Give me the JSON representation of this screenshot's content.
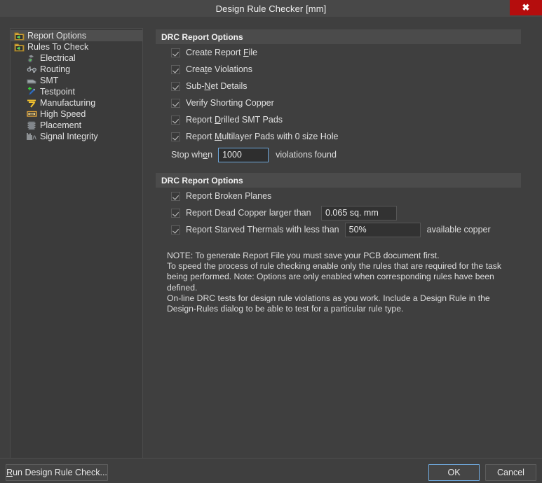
{
  "window": {
    "title": "Design Rule Checker [mm]",
    "close_label": "✖"
  },
  "sidebar": {
    "items": [
      {
        "label": "Report Options",
        "icon": "folder-arrow-icon",
        "level": 0,
        "selected": true
      },
      {
        "label": "Rules To Check",
        "icon": "folder-arrow-icon",
        "level": 0,
        "selected": false
      },
      {
        "label": "Electrical",
        "icon": "electrical-icon",
        "level": 1,
        "selected": false
      },
      {
        "label": "Routing",
        "icon": "routing-icon",
        "level": 1,
        "selected": false
      },
      {
        "label": "SMT",
        "icon": "smt-icon",
        "level": 1,
        "selected": false
      },
      {
        "label": "Testpoint",
        "icon": "testpoint-icon",
        "level": 1,
        "selected": false
      },
      {
        "label": "Manufacturing",
        "icon": "manufacturing-icon",
        "level": 1,
        "selected": false
      },
      {
        "label": "High Speed",
        "icon": "high-speed-icon",
        "level": 1,
        "selected": false
      },
      {
        "label": "Placement",
        "icon": "placement-icon",
        "level": 1,
        "selected": false
      },
      {
        "label": "Signal Integrity",
        "icon": "signal-integrity-icon",
        "level": 1,
        "selected": false
      }
    ]
  },
  "section1": {
    "header": "DRC Report Options",
    "options": [
      {
        "label": "Create Report File",
        "accel": "F",
        "checked": true
      },
      {
        "label": "Create Violations",
        "accel": "t",
        "checked": true
      },
      {
        "label": "Sub-Net Details",
        "accel": "N",
        "checked": true
      },
      {
        "label": "Verify Shorting Copper",
        "accel": "",
        "checked": true
      },
      {
        "label": "Report Drilled SMT Pads",
        "accel": "D",
        "checked": true
      },
      {
        "label": "Report Multilayer Pads with 0 size Hole",
        "accel": "M",
        "checked": true
      }
    ],
    "stop_when": {
      "label_before": "Stop wh",
      "label_accel": "e",
      "label_after": "n",
      "value": "1000",
      "placeholder": "",
      "suffix": "violations found"
    }
  },
  "section2": {
    "header": "DRC Report Options",
    "options": [
      {
        "label": "Report Broken Planes",
        "checked": true,
        "field": null,
        "suffix": ""
      },
      {
        "label": "Report Dead Copper larger than",
        "checked": true,
        "field": "0.065 sq. mm",
        "suffix": ""
      },
      {
        "label": "Report Starved Thermals with less than",
        "checked": true,
        "field": "50%",
        "suffix": "available copper"
      }
    ]
  },
  "note": {
    "text": "NOTE: To generate Report File you must save your PCB document first.\nTo speed the process of rule checking enable only the rules that are required for the task\nbeing performed.  Note: Options are only enabled when corresponding rules have been\ndefined.\nOn-line DRC tests for design rule violations as you work. Include a Design Rule in the\nDesign-Rules dialog to be able to test for a particular rule  type."
  },
  "footer": {
    "run_label_before": "R",
    "run_label_after": "un Design Rule Check...",
    "ok_label": "OK",
    "cancel_label": "Cancel"
  },
  "colors": {
    "window_bg": "#3f3f3f",
    "titlebar_bg": "#484848",
    "close_red": "#b50d0d",
    "section_header_bg": "#4b4b4b",
    "focus_blue": "#6fa8dc",
    "selected_row": "#4e4e4e"
  }
}
